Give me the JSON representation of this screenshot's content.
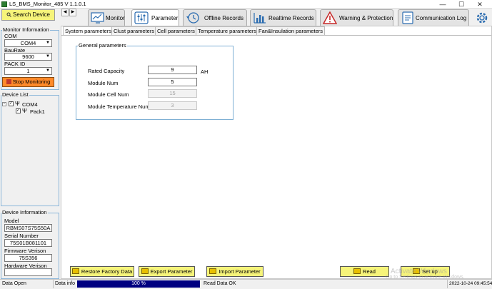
{
  "window": {
    "title": "LS_BMS_Monitor_485 V 1.1.0.1",
    "minimize_glyph": "—",
    "maximize_glyph": "☐",
    "close_glyph": "✕"
  },
  "sidebar": {
    "search_button": "Search Device",
    "monitor_info": {
      "title": "Monitor Information",
      "com_label": "COM",
      "com_value": "COM4",
      "baud_label": "BauRate",
      "baud_value": "9600",
      "pack_label": "PACK ID",
      "pack_value": "1"
    },
    "stop_button": "Stop Monitoring",
    "device_list": {
      "title": "Device List",
      "port": "COM4",
      "pack": "Pack1"
    },
    "device_info": {
      "title": "Device Information",
      "model_label": "Model",
      "model_value": "RBMS07S75S50A",
      "serial_label": "Serial Number",
      "serial_value": "75S01B081101",
      "firmware_label": "Firmware Verison",
      "firmware_value": "75S356",
      "hardware_label": "Hardware Verison",
      "hardware_value": ""
    }
  },
  "nav": {
    "prev": "◀",
    "next": "▶"
  },
  "tabs": [
    {
      "label": "Monitor",
      "icon": "monitor-chart-icon"
    },
    {
      "label": "Parameter",
      "icon": "sliders-icon"
    },
    {
      "label": "Offline Records",
      "icon": "history-clock-icon"
    },
    {
      "label": "Realtime Records",
      "icon": "bar-chart-icon"
    },
    {
      "label": "Warning & Protection",
      "icon": "warning-triangle-icon"
    },
    {
      "label": "Communication Log",
      "icon": "document-log-icon"
    }
  ],
  "settings_icon": "gear-icon",
  "subtabs": [
    "System parameters",
    "Clust parameters",
    "Cell parameters",
    "Temperature parameters",
    "Fan&Insulation parameters"
  ],
  "general": {
    "title": "General parameters",
    "rated_capacity_label": "Rated Capacity",
    "rated_capacity_value": "9",
    "rated_capacity_unit": "AH",
    "module_num_label": "Module Num",
    "module_num_value": "5",
    "cell_num_label": "Module Cell Num",
    "cell_num_value": "15",
    "temp_num_label": "Module Temperature Num",
    "temp_num_value": "3"
  },
  "buttons": {
    "restore": "Restore Factory Data",
    "export": "Export Parameter",
    "import": "Import Parameter",
    "read": "Read",
    "setup": "Set up"
  },
  "watermark": {
    "line1": "Activate Windows",
    "line2": "Go to Settings to activate Windows."
  },
  "status": {
    "data_open": "Data Open",
    "data_info": "Data info",
    "progress_label": "100 %",
    "progress": 1.0,
    "read_status": "Read Data OK",
    "timestamp": "2022-10-24 09:45:54"
  },
  "colors": {
    "button_yellow": "#f6f47a",
    "stop_orange": "#ff8a2a",
    "progress_navy": "#000080",
    "group_border": "#8bb6d9"
  }
}
